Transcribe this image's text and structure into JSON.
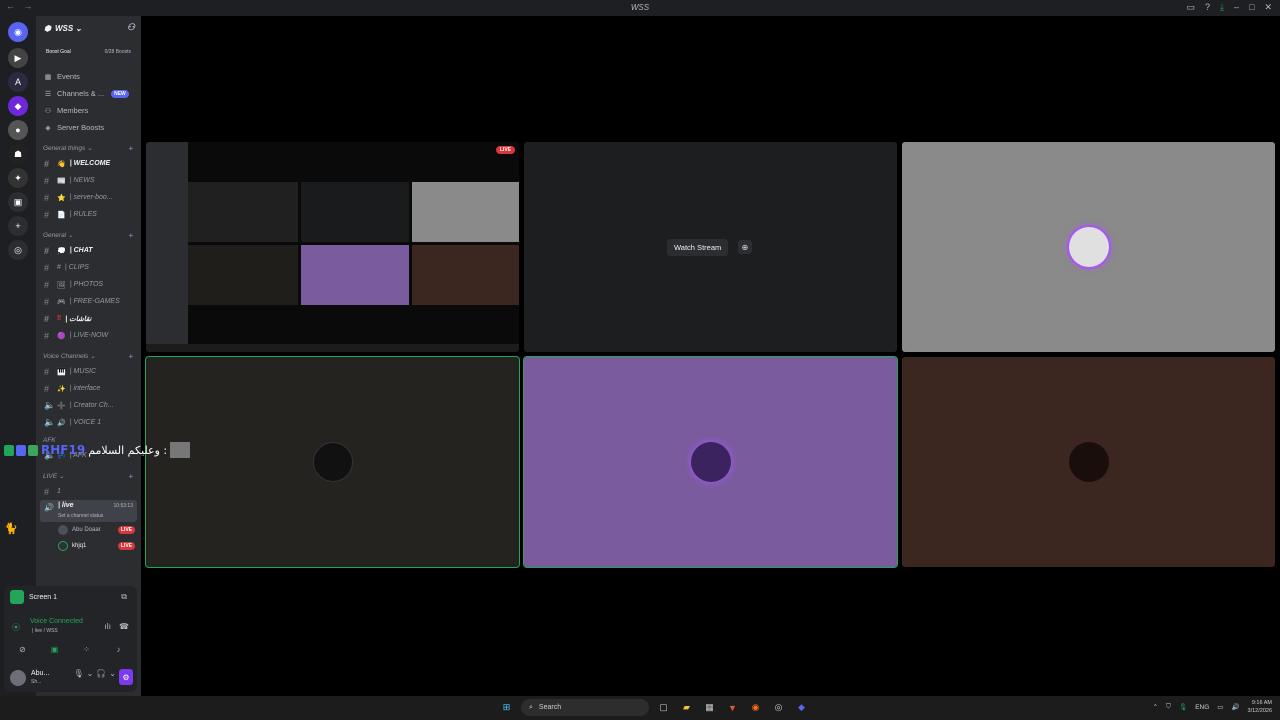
{
  "window": {
    "title": "WSS",
    "nav_arrows": "← →",
    "icons": [
      "inbox-icon",
      "help-icon",
      "download-icon",
      "minimize-icon",
      "maximize-icon",
      "close-icon"
    ]
  },
  "server_rail": {
    "items": [
      "home",
      "server-1",
      "server-2",
      "server-3",
      "server-4",
      "server-5",
      "server-6",
      "server-7",
      "add-server",
      "discover"
    ]
  },
  "sidebar": {
    "guild_name": "WSS",
    "boost_goal": {
      "label": "Boost Goal",
      "value": "0/28 Boosts"
    },
    "menu": [
      {
        "label": "Events",
        "icon": "calendar-icon"
      },
      {
        "label": "Channels & ...",
        "icon": "channels-icon",
        "badge": "NEW"
      },
      {
        "label": "Members",
        "icon": "members-icon"
      },
      {
        "label": "Server Boosts",
        "icon": "boost-icon"
      }
    ],
    "categories": {
      "general_things": "General things",
      "general": "General",
      "voice": "Voice Channels",
      "live": "LIVE"
    },
    "channels_general_things": [
      {
        "label": "| WELCOME",
        "emoji": "👋",
        "bold": true
      },
      {
        "label": "| NEWS",
        "emoji": "📰"
      },
      {
        "label": "| server-boo...",
        "emoji": "⭐"
      },
      {
        "label": "| RULES",
        "emoji": "📄"
      }
    ],
    "channels_general": [
      {
        "label": "| CHAT",
        "emoji": "💭",
        "bold": true
      },
      {
        "label": "| CLIPS",
        "emoji": "#"
      },
      {
        "label": "| PHOTOS",
        "emoji": "🖼"
      },
      {
        "label": "| FREE-GAMES",
        "emoji": "🎮"
      },
      {
        "label": "| نقاشات",
        "emoji": "‼"
      },
      {
        "label": "| LIVE-NOW",
        "emoji": "🟣"
      }
    ],
    "voice_channels": [
      {
        "label": "| MUSIC",
        "emoji": "🎹"
      },
      {
        "label": "| interface",
        "emoji": "✨"
      },
      {
        "label": "| Creator Ch...",
        "emoji": "➕"
      },
      {
        "label": "| VOICE 1",
        "emoji": "🔊"
      }
    ],
    "afk_category": "AFK",
    "afk_channel": {
      "label": "| AFK",
      "emoji": "💤"
    },
    "live_text_channel": "1",
    "live_voice": {
      "label": "| live",
      "time": "10:53:13",
      "status": "Set a channel status"
    },
    "live_members": [
      {
        "name": "Abu Doaar",
        "badge": "LIVE"
      },
      {
        "name": "khjq1",
        "badge": "LIVE"
      }
    ]
  },
  "user_panel": {
    "screen_label": "Screen 1",
    "voice_status": "Voice Connected",
    "voice_location": "| live / WSS",
    "username": "Abu...",
    "user_status": "Sh..."
  },
  "stage": {
    "tiles": [
      {
        "kind": "stream-preview",
        "live": "LIVE"
      },
      {
        "kind": "stream-watch",
        "button": "Watch Stream"
      },
      {
        "kind": "avatar",
        "bg": "#8a8a8a"
      },
      {
        "kind": "avatar",
        "bg": "#252320",
        "speaking": true
      },
      {
        "kind": "avatar",
        "bg": "#7a5c9e",
        "speaking": true
      },
      {
        "kind": "avatar",
        "bg": "#3b2620"
      }
    ]
  },
  "overlay": {
    "name": "RHF19",
    "message": "وعليكم السلامم :"
  },
  "taskbar": {
    "search": "Search",
    "lang": "ENG",
    "time": "9:16 AM",
    "date": "3/12/2026"
  },
  "colors": {
    "accent": "#5865f2",
    "live_red": "#da373c",
    "speaking_green": "#23a55a",
    "sidebar_bg": "#2b2d31",
    "rail_bg": "#1e1f22"
  }
}
